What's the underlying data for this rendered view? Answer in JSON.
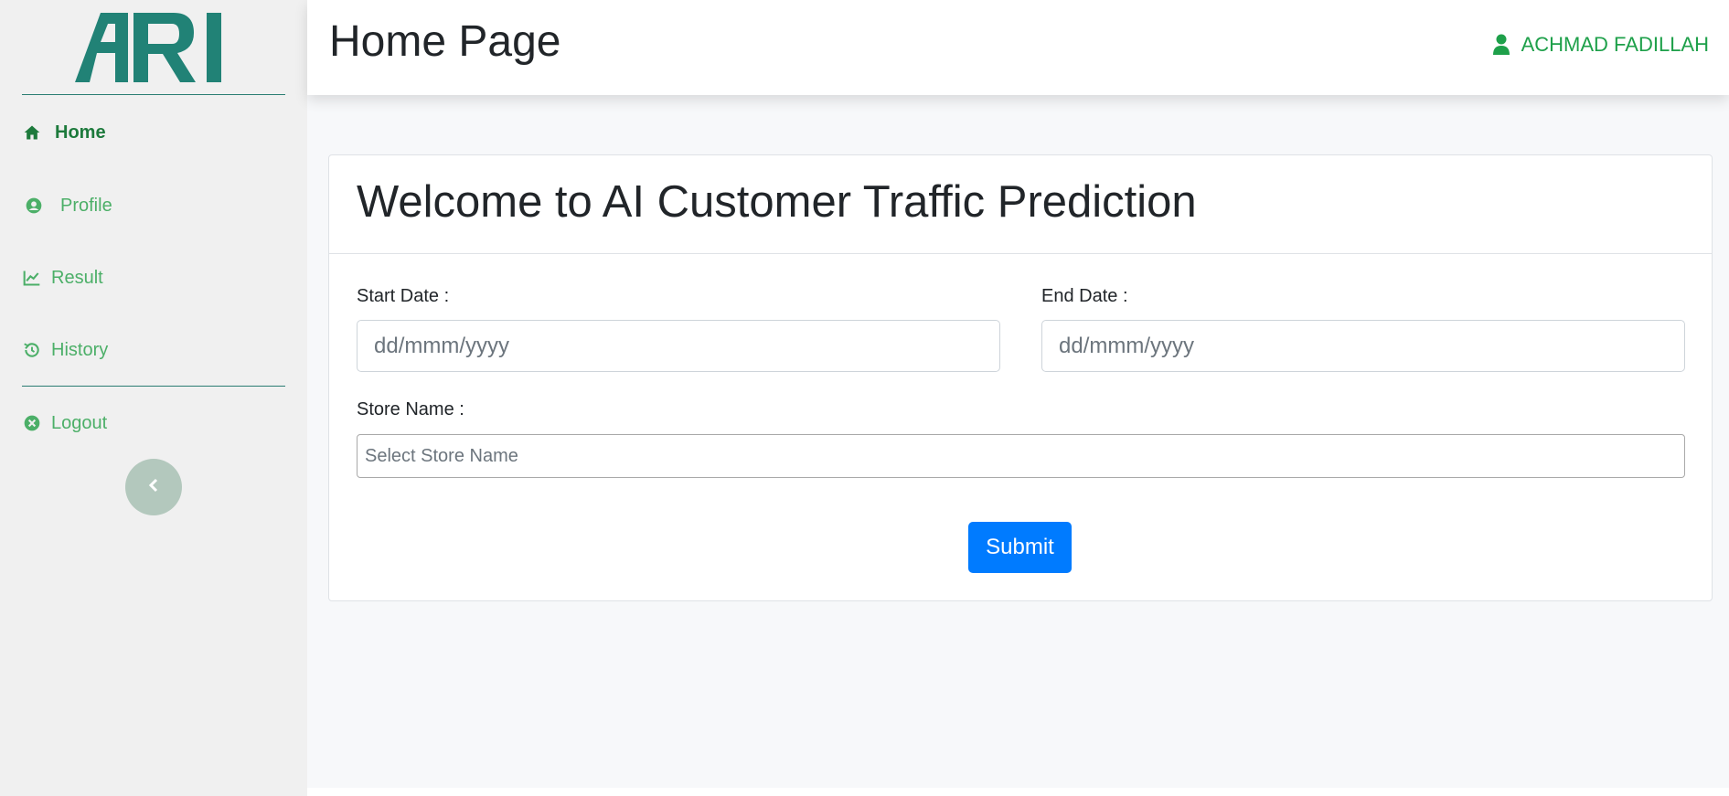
{
  "logo": {
    "text": "ARI",
    "color": "#218276"
  },
  "sidebar": {
    "items": [
      {
        "label": "Home",
        "icon": "home-icon",
        "active": true
      },
      {
        "label": "Profile",
        "icon": "user-circle-icon",
        "active": false
      },
      {
        "label": "Result",
        "icon": "chart-line-icon",
        "active": false
      },
      {
        "label": "History",
        "icon": "history-icon",
        "active": false
      },
      {
        "label": "Logout",
        "icon": "times-circle-icon",
        "active": false
      }
    ],
    "collapse_icon": "chevron-left-icon"
  },
  "header": {
    "title": "Home Page",
    "user_name": "ACHMAD FADILLAH",
    "user_icon": "user-icon"
  },
  "card": {
    "title": "Welcome to AI Customer Traffic Prediction",
    "start_date_label": "Start Date :",
    "start_date_placeholder": "dd/mmm/yyyy",
    "end_date_label": "End Date :",
    "end_date_placeholder": "dd/mmm/yyyy",
    "store_label": "Store Name :",
    "store_placeholder": "Select Store Name",
    "submit_label": "Submit"
  },
  "colors": {
    "accent_green": "#1ea04a",
    "nav_green": "#4caf68",
    "primary_blue": "#007bff"
  }
}
